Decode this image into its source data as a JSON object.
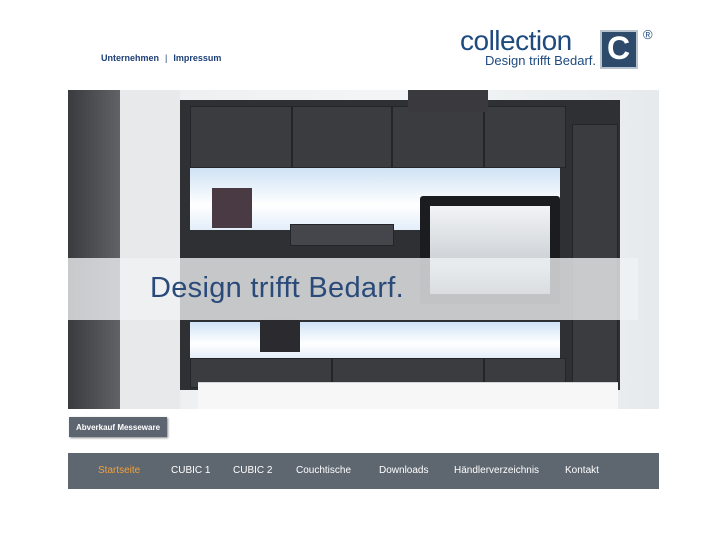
{
  "top_links": {
    "company": "Unternehmen",
    "separator": "|",
    "imprint": "Impressum"
  },
  "logo": {
    "word": "collection",
    "letter": "C",
    "registered": "®",
    "tagline": "Design trifft Bedarf."
  },
  "hero": {
    "slogan": "Design trifft Bedarf."
  },
  "sale_button": "Abverkauf Messeware",
  "nav": {
    "items": [
      {
        "label": "Startseite",
        "active": true
      },
      {
        "label": "CUBIC 1",
        "active": false
      },
      {
        "label": "CUBIC 2",
        "active": false
      },
      {
        "label": "Couchtische",
        "active": false
      },
      {
        "label": "Downloads",
        "active": false
      },
      {
        "label": "Händlerverzeichnis",
        "active": false
      },
      {
        "label": "Kontakt",
        "active": false
      }
    ]
  },
  "colors": {
    "brand_blue": "#1f4a80",
    "nav_background": "#5e6670",
    "nav_active": "#f0a13a"
  }
}
